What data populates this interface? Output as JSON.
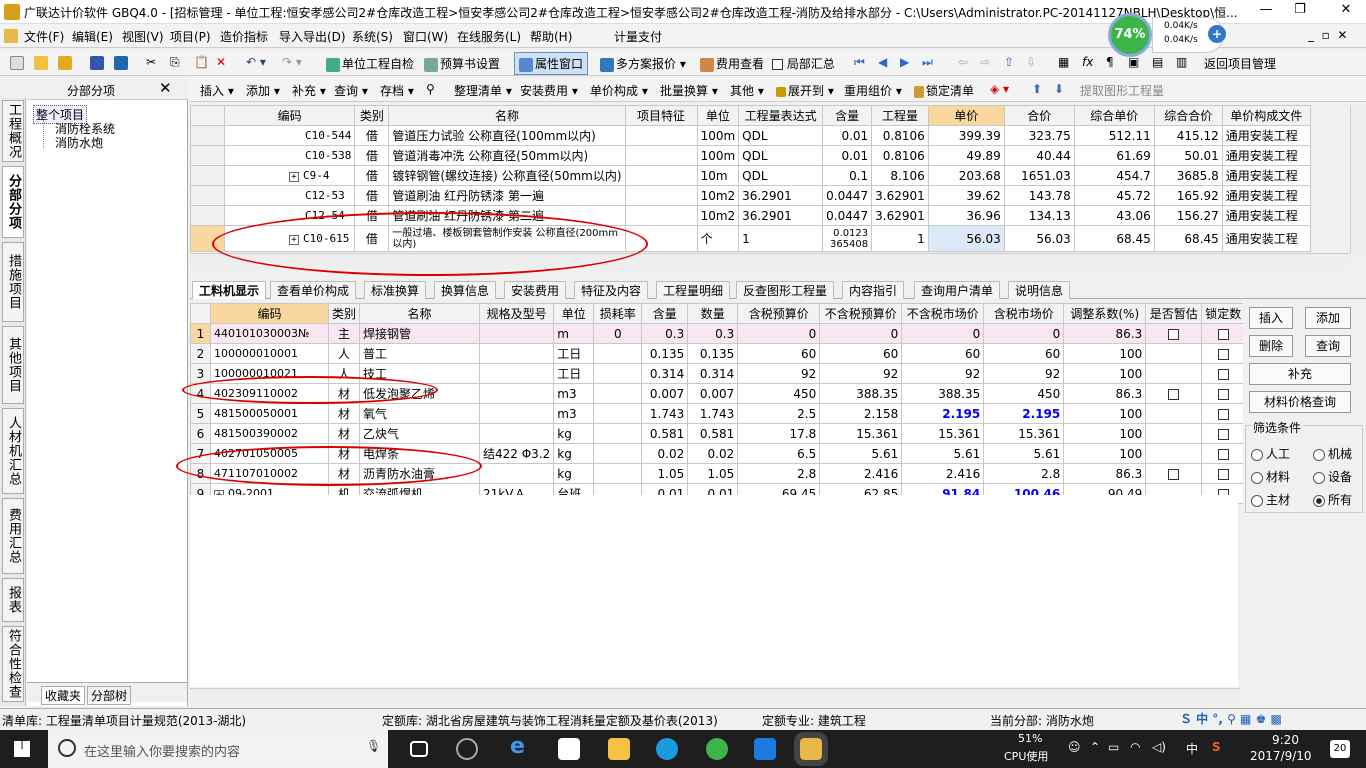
{
  "titlebar": {
    "title": "广联达计价软件 GBQ4.0 - [招标管理 - 单位工程:恒安孝感公司2#仓库改造工程>恒安孝感公司2#仓库改造工程>恒安孝感公司2#仓库改造工程-消防及给排水部分 - C:\\Users\\Administrator.PC-20141127NBLH\\Desktop\\恒..."
  },
  "menu": [
    "文件(F)",
    "编辑(E)",
    "视图(V)",
    "项目(P)",
    "造价指标",
    "导入导出(D)",
    "系统(S)",
    "窗口(W)",
    "在线服务(L)",
    "帮助(H)",
    "计量支付"
  ],
  "toolbar1": {
    "check": "单位工程自检",
    "budget": "预算书设置",
    "attr": "属性窗口",
    "multi": "多方案报价",
    "fee_view": "费用查看",
    "partial": "局部汇总",
    "back": "返回项目管理"
  },
  "toolbar2": [
    "插入",
    "添加",
    "补充",
    "查询",
    "存档",
    "整理清单",
    "安装费用",
    "单价构成",
    "批量换算",
    "其他",
    "展开到",
    "重用组价",
    "锁定清单",
    "提取图形工程量"
  ],
  "speed": {
    "percent": "74%",
    "up": "0.04K/s",
    "down": "0.04K/s"
  },
  "left_tabs": [
    "工程概况",
    "分部分项",
    "措施项目",
    "其他项目",
    "人材机汇总",
    "费用汇总",
    "报表",
    "符合性检查"
  ],
  "left_panel": {
    "title": "分部分项",
    "root": "整个项目",
    "items": [
      "消防栓系统",
      "消防水炮"
    ],
    "bottom_tabs": [
      "收藏夹",
      "分部树"
    ]
  },
  "top_table": {
    "headers": [
      "编码",
      "类别",
      "名称",
      "项目特征",
      "单位",
      "工程量表达式",
      "含量",
      "工程量",
      "单价",
      "合价",
      "综合单价",
      "综合合价",
      "单价构成文件"
    ],
    "rows": [
      [
        "C10-544",
        "借",
        "管道压力试验 公称直径(100mm以内)",
        "",
        "100m",
        "QDL",
        "0.01",
        "0.8106",
        "399.39",
        "323.75",
        "512.11",
        "415.12",
        "通用安装工程"
      ],
      [
        "C10-538",
        "借",
        "管道消毒冲洗 公称直径(50mm以内)",
        "",
        "100m",
        "QDL",
        "0.01",
        "0.8106",
        "49.89",
        "40.44",
        "61.69",
        "50.01",
        "通用安装工程"
      ],
      [
        "C9-4",
        "借",
        "镀锌钢管(螺纹连接) 公称直径(50mm以内)",
        "",
        "10m",
        "QDL",
        "0.1",
        "8.106",
        "203.68",
        "1651.03",
        "454.7",
        "3685.8",
        "通用安装工程"
      ],
      [
        "C12-53",
        "借",
        "管道刷油 红丹防锈漆 第一遍",
        "",
        "10m2",
        "36.2901",
        "0.0447",
        "3.62901",
        "39.62",
        "143.78",
        "45.72",
        "165.92",
        "通用安装工程"
      ],
      [
        "C12-54",
        "借",
        "管道刷油 红丹防锈漆 第二遍",
        "",
        "10m2",
        "36.2901",
        "0.0447",
        "3.62901",
        "36.96",
        "134.13",
        "43.06",
        "156.27",
        "通用安装工程"
      ],
      [
        "C10-615",
        "借",
        "一般过墙、楼板钢套管制作安装 公称直径(200mm以内)",
        "",
        "个",
        "1",
        "0.0123 365408",
        "1",
        "56.03",
        "56.03",
        "68.45",
        "68.45",
        "通用安装工程"
      ]
    ]
  },
  "mid_tabs": [
    "工料机显示",
    "查看单价构成",
    "标准换算",
    "换算信息",
    "安装费用",
    "特征及内容",
    "工程量明细",
    "反查图形工程量",
    "内容指引",
    "查询用户清单",
    "说明信息"
  ],
  "bottom_table": {
    "headers": [
      "",
      "编码",
      "类别",
      "名称",
      "规格及型号",
      "单位",
      "损耗率",
      "含量",
      "数量",
      "含税预算价",
      "不含税预算价",
      "不含税市场价",
      "含税市场价",
      "调整系数(%)",
      "是否暂估",
      "锁定数"
    ],
    "rows": [
      [
        "1",
        "440101030003№",
        "主",
        "焊接钢管",
        "",
        "m",
        "0",
        "0.3",
        "0.3",
        "0",
        "0",
        "0",
        "0",
        "86.3"
      ],
      [
        "2",
        "100000010001",
        "人",
        "普工",
        "",
        "工日",
        "",
        "0.135",
        "0.135",
        "60",
        "60",
        "60",
        "60",
        "100"
      ],
      [
        "3",
        "100000010021",
        "人",
        "技工",
        "",
        "工日",
        "",
        "0.314",
        "0.314",
        "92",
        "92",
        "92",
        "92",
        "100"
      ],
      [
        "4",
        "402309110002",
        "材",
        "低发泡聚乙烯",
        "",
        "m3",
        "",
        "0.007",
        "0.007",
        "450",
        "388.35",
        "388.35",
        "450",
        "86.3"
      ],
      [
        "5",
        "481500050001",
        "材",
        "氧气",
        "",
        "m3",
        "",
        "1.743",
        "1.743",
        "2.5",
        "2.158",
        "2.195",
        "2.195",
        "100"
      ],
      [
        "6",
        "481500390002",
        "材",
        "乙炔气",
        "",
        "kg",
        "",
        "0.581",
        "0.581",
        "17.8",
        "15.361",
        "15.361",
        "15.361",
        "100"
      ],
      [
        "7",
        "402701050005",
        "材",
        "电焊条",
        "结422 Φ3.2",
        "kg",
        "",
        "0.02",
        "0.02",
        "6.5",
        "5.61",
        "5.61",
        "5.61",
        "100"
      ],
      [
        "8",
        "471107010002",
        "材",
        "沥青防水油膏",
        "",
        "kg",
        "",
        "1.05",
        "1.05",
        "2.8",
        "2.416",
        "2.416",
        "2.8",
        "86.3"
      ],
      [
        "9",
        "09-2001",
        "机",
        "交流弧焊机",
        "21kV.A",
        "台班",
        "",
        "0.01",
        "0.01",
        "69.45",
        "62.85",
        "91.84",
        "100.46",
        "90.49"
      ]
    ]
  },
  "right_panel": {
    "insert": "插入",
    "add": "添加",
    "delete": "删除",
    "query": "查询",
    "supplement": "补充",
    "price_query": "材料价格查询",
    "filter_title": "筛选条件",
    "filters": [
      "人工",
      "机械",
      "材料",
      "设备",
      "主材",
      "所有"
    ]
  },
  "status": {
    "list_lib": "清单库:  工程量清单项目计量规范(2013-湖北)",
    "quota_lib": "定额库:  湖北省房屋建筑与装饰工程消耗量定额及基价表(2013)",
    "quota_major": "定额专业:  建筑工程",
    "current_part": "当前分部:  消防水炮"
  },
  "taskbar": {
    "search": "在这里输入你要搜索的内容",
    "cpu_pct": "51%",
    "cpu_label": "CPU使用",
    "ime": "中",
    "time": "9:20",
    "date": "2017/9/10",
    "notif": "20"
  }
}
